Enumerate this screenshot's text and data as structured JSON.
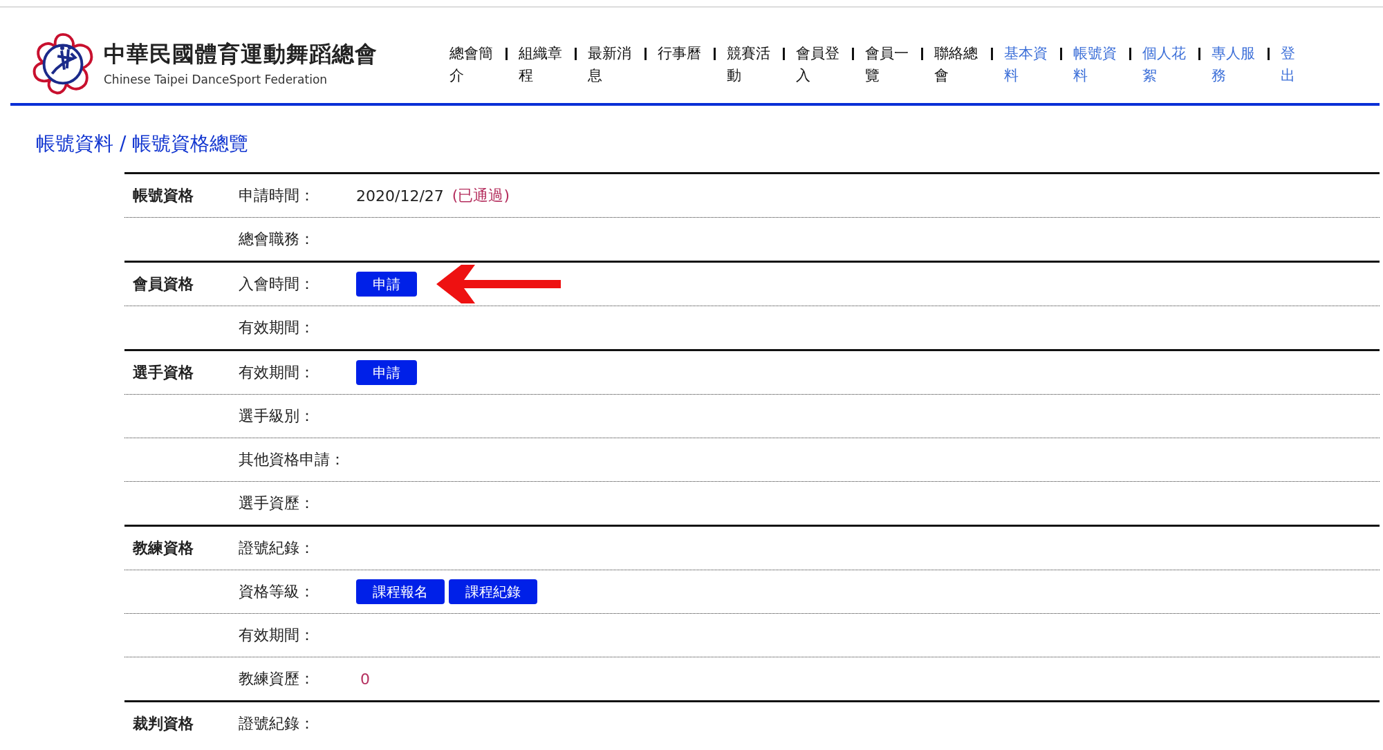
{
  "header": {
    "title": "中華民國體育運動舞蹈總會",
    "subtitle": "Chinese Taipei DanceSport Federation"
  },
  "nav": [
    {
      "label": "總會簡介",
      "kind": "public"
    },
    {
      "label": "組織章程",
      "kind": "public"
    },
    {
      "label": "最新消息",
      "kind": "public"
    },
    {
      "label": "行事曆",
      "kind": "public"
    },
    {
      "label": "競賽活動",
      "kind": "public"
    },
    {
      "label": "會員登入",
      "kind": "public"
    },
    {
      "label": "會員一覽",
      "kind": "public"
    },
    {
      "label": "聯絡總會",
      "kind": "public"
    },
    {
      "label": "基本資料",
      "kind": "member"
    },
    {
      "label": "帳號資料",
      "kind": "member"
    },
    {
      "label": "個人花絮",
      "kind": "member"
    },
    {
      "label": "專人服務",
      "kind": "member"
    },
    {
      "label": "登出",
      "kind": "member"
    }
  ],
  "breadcrumb": "帳號資料 / 帳號資格總覽",
  "sections": [
    {
      "title": "帳號資格",
      "rows": [
        {
          "label": "申請時間：",
          "value": "2020/12/27",
          "note": "(已通過)"
        },
        {
          "label": "總會職務："
        }
      ]
    },
    {
      "title": "會員資格",
      "rows": [
        {
          "label": "入會時間：",
          "buttons": [
            "申請"
          ],
          "arrow": true
        },
        {
          "label": "有效期間："
        }
      ]
    },
    {
      "title": "選手資格",
      "rows": [
        {
          "label": "有效期間：",
          "buttons": [
            "申請"
          ]
        },
        {
          "label": "選手級別："
        },
        {
          "label": "其他資格申請："
        },
        {
          "label": "選手資歷："
        }
      ]
    },
    {
      "title": "教練資格",
      "rows": [
        {
          "label": "證號紀錄："
        },
        {
          "label": "資格等級：",
          "buttons": [
            "課程報名",
            "課程紀錄"
          ]
        },
        {
          "label": "有效期間："
        },
        {
          "label": "教練資歷：",
          "note": "0"
        }
      ]
    },
    {
      "title": "裁判資格",
      "rows": [
        {
          "label": "證號紀錄："
        }
      ]
    }
  ]
}
